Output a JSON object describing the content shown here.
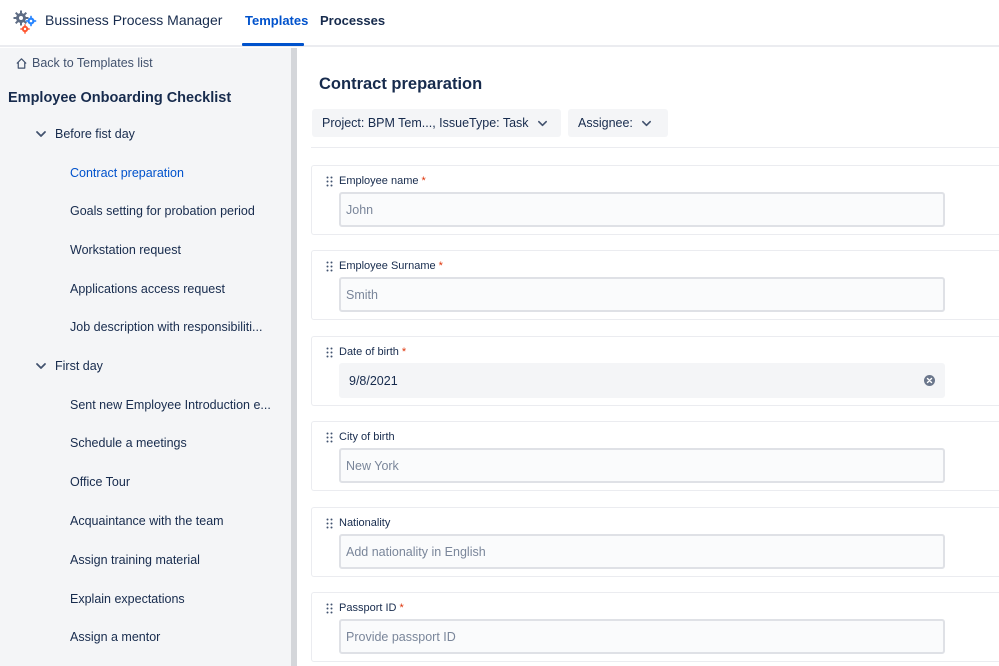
{
  "header": {
    "app_title": "Bussiness Process Manager",
    "tabs": [
      {
        "label": "Templates",
        "active": true
      },
      {
        "label": "Processes",
        "active": false
      }
    ],
    "logo_icon": "gears-icon"
  },
  "sidebar": {
    "back_label": "Back to Templates list",
    "back_icon": "home-icon",
    "checklist_title": "Employee Onboarding Checklist",
    "groups": [
      {
        "label": "Before fist day",
        "expanded": true,
        "items": [
          {
            "label": "Contract preparation",
            "selected": true
          },
          {
            "label": "Goals setting for probation period"
          },
          {
            "label": "Workstation request"
          },
          {
            "label": "Applications access request"
          },
          {
            "label": "Job description with responsibiliti..."
          }
        ]
      },
      {
        "label": "First day",
        "expanded": true,
        "items": [
          {
            "label": "Sent new Employee Introduction e..."
          },
          {
            "label": "Schedule a meetings"
          },
          {
            "label": "Office Tour"
          },
          {
            "label": "Acquaintance with the team"
          },
          {
            "label": "Assign training material"
          },
          {
            "label": "Explain expectations"
          },
          {
            "label": "Assign a mentor"
          }
        ]
      }
    ]
  },
  "main": {
    "title": "Contract preparation",
    "filters": {
      "project": "Project: BPM Tem..., IssueType: Task",
      "assignee": "Assignee:"
    },
    "fields": [
      {
        "label": "Employee name",
        "required": "*",
        "placeholder": "John"
      },
      {
        "label": "Employee Surname",
        "required": "*",
        "placeholder": "Smith"
      },
      {
        "label": "Date of birth",
        "required": "*",
        "value": "9/8/2021"
      },
      {
        "label": "City of birth",
        "required": "",
        "placeholder": "New York"
      },
      {
        "label": "Nationality",
        "required": "",
        "placeholder": "Add nationality in English"
      },
      {
        "label": "Passport ID",
        "required": "*",
        "placeholder": "Provide passport ID"
      }
    ]
  },
  "colors": {
    "accent": "#0052cc",
    "required": "#de350b",
    "sidebar_bg": "#f4f5f7"
  }
}
